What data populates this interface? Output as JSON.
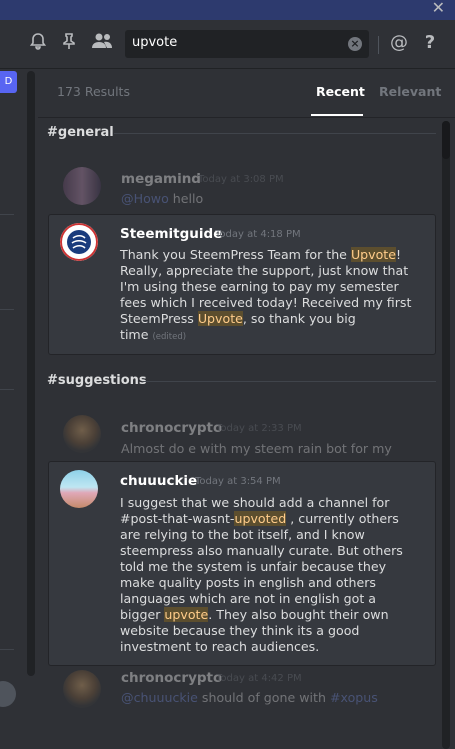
{
  "header": {
    "close_glyph": "✕",
    "search_value": "upvote",
    "at_glyph": "@",
    "help_glyph": "?",
    "left_button": "D"
  },
  "results": {
    "count": "173 Results",
    "tabs": [
      {
        "label": "Recent",
        "active": true
      },
      {
        "label": "Relevant",
        "active": false
      }
    ]
  },
  "groups": [
    {
      "channel": "#general",
      "messages": [
        {
          "author": "megamind",
          "timestamp": "Today at 3:08 PM",
          "mention": "@Howo",
          "text": " hello",
          "context": true
        },
        {
          "author": "Steemitguide",
          "timestamp": "Today at 4:18 PM",
          "context": false,
          "lines": [
            "Thank you SteemPress Team for the |Upvote|!",
            "Really, appreciate the support, just know that",
            "I'm using these earning to pay my semester",
            "fees which I received today! Received my first",
            "SteemPress |Upvote|, so thank you big",
            "time"
          ],
          "edited": "(edited)"
        }
      ]
    },
    {
      "channel": "#suggestions",
      "messages": [
        {
          "author": "chronocrypto",
          "timestamp": "Today at 2:33 PM",
          "text": "Almost do e with my steem rain bot for my",
          "context": true
        },
        {
          "author": "chuuuckie",
          "timestamp": "Today at 3:54 PM",
          "context": false,
          "lines": [
            "I suggest that we should add a channel for",
            "#post-that-wasnt-|upvoted| , currently others",
            "are relying to the bot itself, and I know",
            "steempress also manually curate. But others",
            "told me the system is unfair because they",
            "make quality posts in english and others",
            "languages which are not in english got a",
            "bigger |upvote|. They also bought their own",
            "website because they think its a good",
            "investment to reach audiences."
          ]
        },
        {
          "author": "chronocrypto",
          "timestamp": "Today at 4:42 PM",
          "mention": "@chuuuckie",
          "text": " should of gone with ",
          "tag": "#xopus",
          "context": true
        }
      ]
    }
  ],
  "icons": [
    "bell-icon",
    "pin-icon",
    "members-icon",
    "clear-search-icon",
    "mention-icon",
    "help-icon",
    "close-icon"
  ],
  "colors": {
    "accent": "#5865f2",
    "highlight_bg": "#5c4e2e",
    "highlight_fg": "#ffcc8a",
    "mention": "#7289da",
    "topbar": "#2d3a6e"
  }
}
